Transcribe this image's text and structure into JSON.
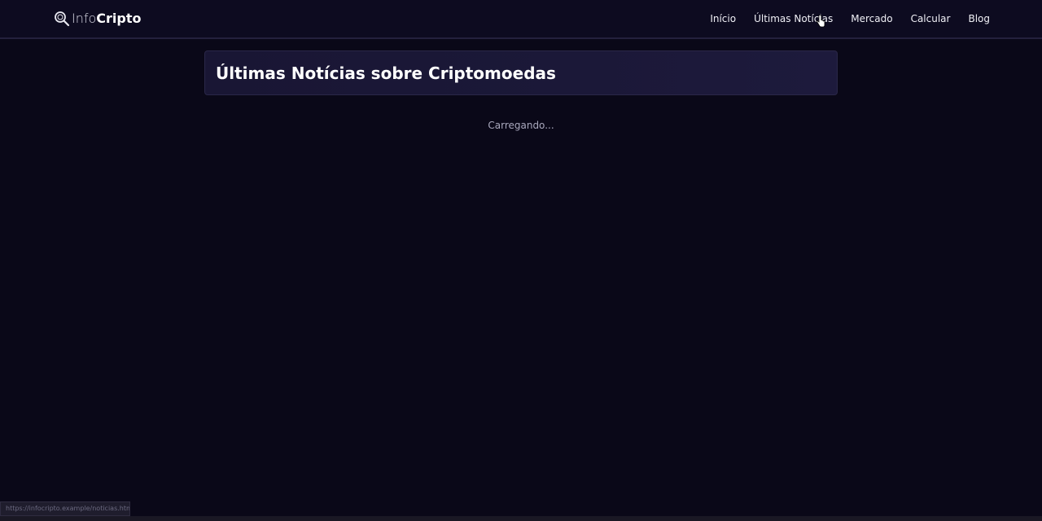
{
  "brand": {
    "name_light": "Info",
    "name_bold": "Cripto",
    "icon": "magnifier-icon"
  },
  "nav": {
    "items": [
      {
        "label": "Início"
      },
      {
        "label": "Últimas Notícias"
      },
      {
        "label": "Mercado"
      },
      {
        "label": "Calcular"
      },
      {
        "label": "Blog"
      }
    ]
  },
  "main": {
    "title": "Últimas Notícias sobre Criptomoedas",
    "loading_text": "Carregando..."
  },
  "status_bar": {
    "url": "https://infocripto.example/noticias.html"
  },
  "colors": {
    "background": "#0a0818",
    "navbar": "#0d0b20",
    "card": "#1b1838",
    "text": "#ffffff",
    "muted_text": "#a9a8bd"
  }
}
